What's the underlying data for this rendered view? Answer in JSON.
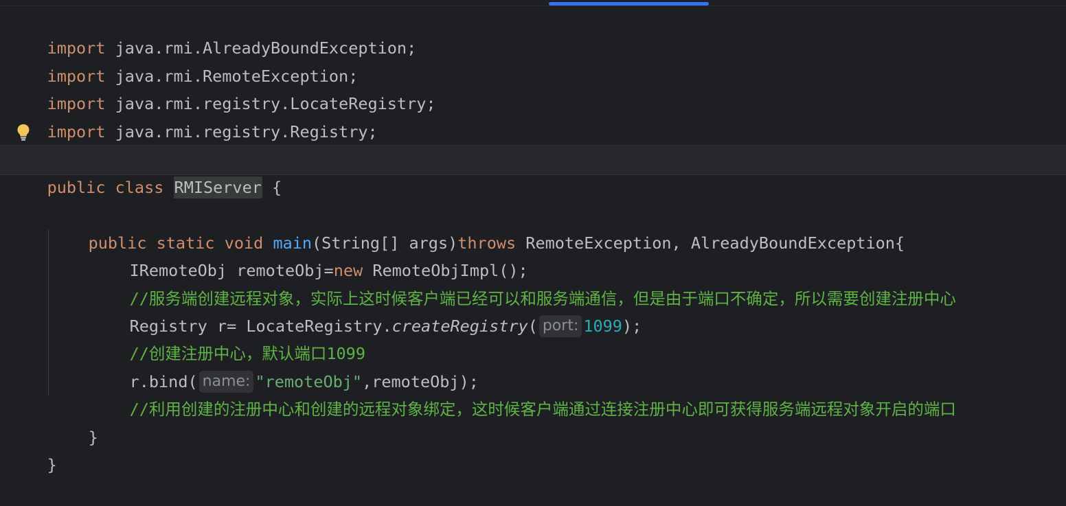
{
  "editor": {
    "accent_color": "#3574f0",
    "lines": {
      "l1": {
        "kw": "import",
        "rest": " java.rmi.AlreadyBoundException;"
      },
      "l2": {
        "kw": "import",
        "rest": " java.rmi.RemoteException;"
      },
      "l3": {
        "kw": "import",
        "rest": " java.rmi.registry.LocateRegistry;"
      },
      "l4": {
        "kw": "import",
        "rest": " java.rmi.registry.Registry;"
      },
      "l6": {
        "kw1": "public",
        "kw2": "class",
        "class_name": "RMIServer",
        "brace": " {"
      },
      "l8": {
        "kw1": "public",
        "kw2": "static",
        "kw3": "void",
        "method": "main",
        "params": "(String[] args)",
        "throws_kw": "throws",
        "exceptions": " RemoteException, AlreadyBoundException{"
      },
      "l9": {
        "type": "IRemoteObj remoteObj=",
        "new_kw": "new",
        "rest": " RemoteObjImpl();"
      },
      "l10": {
        "comment": "//服务端创建远程对象，实际上这时候客户端已经可以和服务端通信，但是由于端口不确定，所以需要创建注册中心"
      },
      "l11": {
        "prefix": "Registry r= LocateRegistry.",
        "call": "createRegistry",
        "open": "(",
        "hint": "port:",
        "number": "1099",
        "close": ");"
      },
      "l12": {
        "comment": "//创建注册中心，默认端口",
        "number": "1099"
      },
      "l13": {
        "prefix": "r.bind(",
        "hint": "name:",
        "string": "\"remoteObj\"",
        "rest": ",remoteObj);"
      },
      "l14": {
        "comment": "//利用创建的注册中心和创建的远程对象绑定，这时候客户端通过连接注册中心即可获得服务端远程对象开启的端口"
      },
      "l15": {
        "brace": "}"
      },
      "l16": {
        "brace": "}"
      }
    }
  }
}
